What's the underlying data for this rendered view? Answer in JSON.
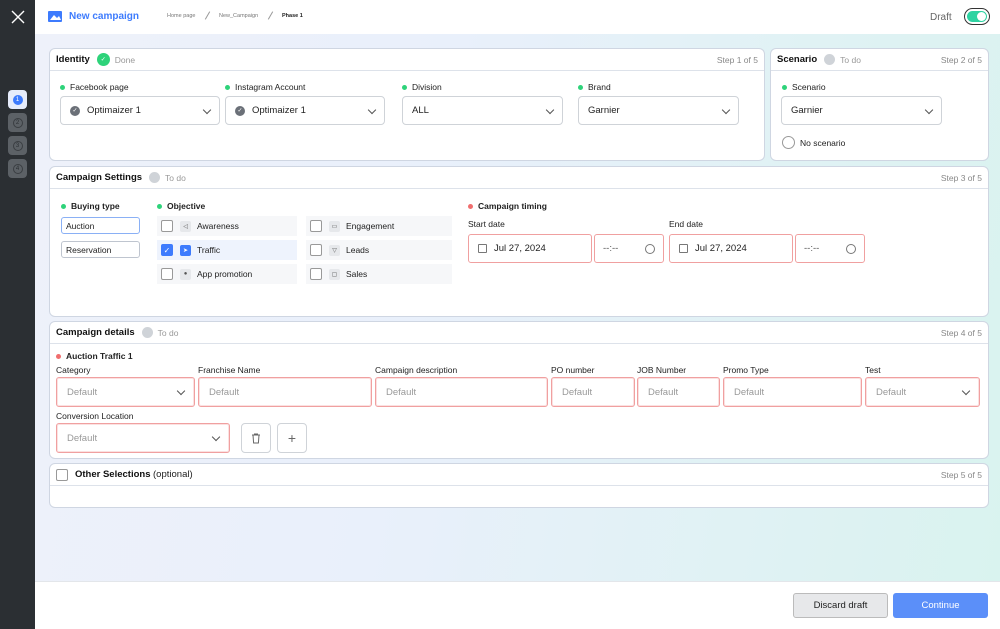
{
  "app": {
    "title": "New campaign",
    "breadcrumbs": [
      "Home page",
      "New_Campaign",
      "Phase 1"
    ],
    "draft_label": "Draft",
    "draft_on": true,
    "accent": "#3d7bfd",
    "success": "#2ed37a",
    "error": "#f06e6e"
  },
  "rail": {
    "steps": [
      "1",
      "2",
      "3",
      "4"
    ],
    "active": "1"
  },
  "identity": {
    "title": "Identity",
    "status": "Done",
    "step": "Step 1 of 5",
    "fields": [
      {
        "label": "Facebook page",
        "value": "Optimaizer 1"
      },
      {
        "label": "Instagram Account",
        "value": "Optimaizer 1"
      },
      {
        "label": "Division",
        "value": "ALL"
      },
      {
        "label": "Brand",
        "value": "Garnier"
      }
    ]
  },
  "scenario": {
    "title": "Scenario",
    "status": "To do",
    "step": "Step 2 of 5",
    "field_label": "Scenario",
    "value": "Garnier",
    "no_scenario": "No scenario"
  },
  "settings": {
    "title": "Campaign Settings",
    "status": "To do",
    "step": "Step 3 of 5",
    "buying_label": "Buying type",
    "buying": [
      "Auction",
      "Reservation"
    ],
    "objective_label": "Objective",
    "objectives": [
      {
        "label": "Awareness",
        "checked": false
      },
      {
        "label": "Engagement",
        "checked": false
      },
      {
        "label": "Traffic",
        "checked": true
      },
      {
        "label": "Leads",
        "checked": false
      },
      {
        "label": "App promotion",
        "checked": false
      },
      {
        "label": "Sales",
        "checked": false
      }
    ],
    "timing_label": "Campaign timing",
    "start_label": "Start date",
    "start": "Jul 27, 2024",
    "start_time": "--:--",
    "end_label": "End date",
    "end": "Jul 27, 2024",
    "end_time": "--:--"
  },
  "details": {
    "title": "Campaign details",
    "status": "To do",
    "step": "Step 4 of 5",
    "sub": "Auction Traffic 1",
    "fields": [
      {
        "label": "Category",
        "placeholder": "Default"
      },
      {
        "label": "Franchise Name",
        "placeholder": "Default"
      },
      {
        "label": "Campaign description",
        "placeholder": "Default"
      },
      {
        "label": "PO number",
        "placeholder": "Default"
      },
      {
        "label": "JOB Number",
        "placeholder": "Default"
      },
      {
        "label": "Promo Type",
        "placeholder": "Default"
      },
      {
        "label": "Test",
        "placeholder": "Default"
      }
    ],
    "conversion_label": "Conversion Location",
    "conversion_placeholder": "Default"
  },
  "other": {
    "title": "Other Selections",
    "optional": "(optional)",
    "step": "Step 5 of 5"
  },
  "footer": {
    "discard": "Discard draft",
    "continue": "Continue"
  }
}
